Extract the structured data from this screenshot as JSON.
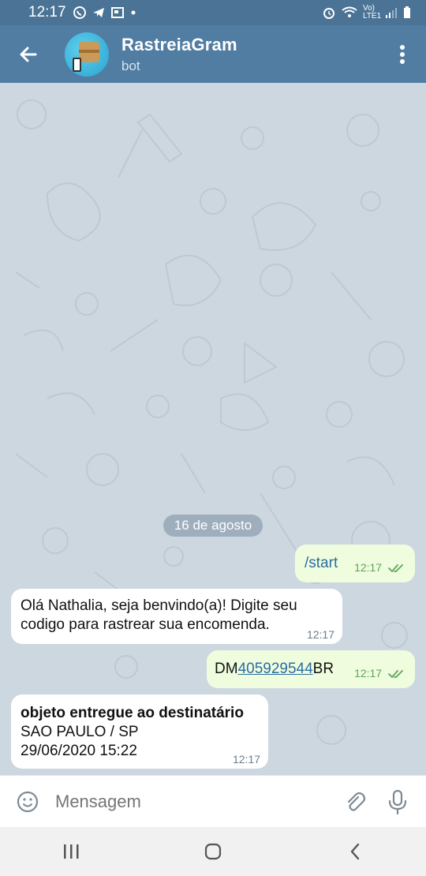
{
  "status_bar": {
    "time": "12:17",
    "network": "Vo) LTE1"
  },
  "header": {
    "title": "RastreiaGram",
    "subtitle": "bot"
  },
  "chat": {
    "date_separator": "16 de agosto",
    "messages": [
      {
        "direction": "outgoing",
        "text": "/start",
        "time": "12:17"
      },
      {
        "direction": "incoming",
        "text": "Olá Nathalia, seja benvindo(a)! Digite seu codigo para rastrear sua encomenda.",
        "time": "12:17"
      },
      {
        "direction": "outgoing",
        "prefix": "DM",
        "link": "405929544",
        "suffix": "BR",
        "time": "12:17"
      },
      {
        "direction": "incoming",
        "line1": "objeto entregue ao destinatário",
        "line2": "SAO PAULO / SP",
        "line3": "29/06/2020 15:22",
        "time": "12:17"
      }
    ]
  },
  "input": {
    "placeholder": "Mensagem"
  },
  "colors": {
    "header": "#517da2",
    "status_bar": "#4a7396",
    "outgoing_bubble": "#effdde",
    "incoming_bubble": "#ffffff",
    "link": "#2b6ca3"
  }
}
